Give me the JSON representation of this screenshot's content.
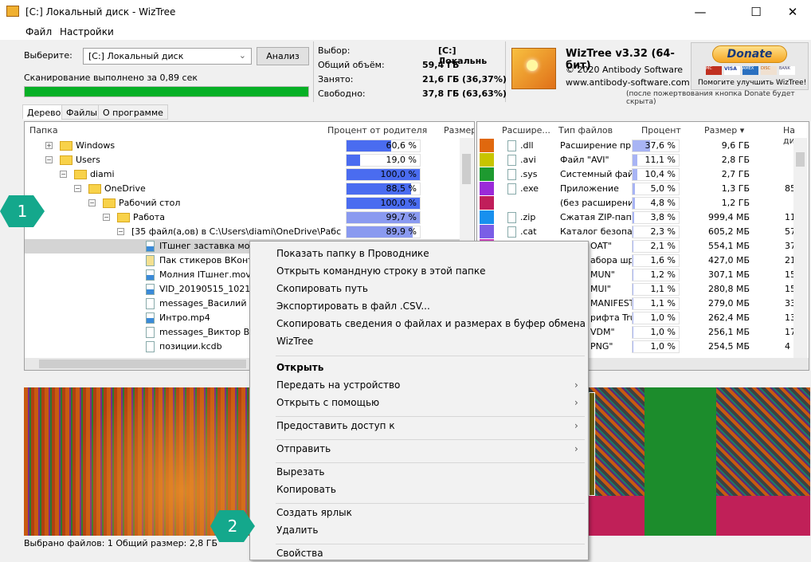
{
  "window": {
    "title": "[C:] Локальный диск  - WizTree",
    "minimize": "—",
    "maximize": "☐",
    "close": "✕"
  },
  "menu": [
    "Файл",
    "Настройки"
  ],
  "scan": {
    "select_label": "Выберите:",
    "drive": "[C:] Локальный диск",
    "analyze": "Анализ",
    "status": "Сканирование выполнено за 0,89 сек",
    "progress_percent": 100
  },
  "stats": {
    "selection_label": "Выбор:",
    "selection_value": "[C:]  Локальнь",
    "total_label": "Общий объём:",
    "total_value": "59,4 ГБ",
    "used_label": "Занято:",
    "used_value": "21,6 ГБ",
    "used_pct": "(36,37%)",
    "free_label": "Свободно:",
    "free_value": "37,8 ГБ",
    "free_pct": "(63,63%)"
  },
  "about": {
    "name": "WizTree v3.32 (64-бит)",
    "copyright": "© 2020 Antibody Software",
    "url": "www.antibody-software.com",
    "donate": "Donate",
    "help": "Помогите улучшить WizTree!",
    "note": "(после пожертвования кнопка Donate будет скрыта)",
    "cards": [
      "MC",
      "VISA",
      "AMEX",
      "DISC",
      "BANK"
    ]
  },
  "tabs": [
    "Дерево",
    "Файлы",
    "О программе"
  ],
  "tree": {
    "headers": [
      "Папка",
      "Процент от родителя",
      "Размер"
    ],
    "rows": [
      {
        "name": "Windows",
        "pct": "60,6 %",
        "fill": 60.6,
        "level": 1,
        "exp": "+",
        "type": "folder"
      },
      {
        "name": "Users",
        "pct": "19,0 %",
        "fill": 19,
        "level": 1,
        "exp": "−",
        "type": "folder"
      },
      {
        "name": "diami",
        "pct": "100,0 %",
        "fill": 100,
        "level": 2,
        "exp": "−",
        "type": "folder"
      },
      {
        "name": "OneDrive",
        "pct": "88,5 %",
        "fill": 88.5,
        "level": 3,
        "exp": "−",
        "type": "folder"
      },
      {
        "name": "Рабочий стол",
        "pct": "100,0 %",
        "fill": 100,
        "level": 4,
        "exp": "−",
        "type": "folder"
      },
      {
        "name": "Работа",
        "pct": "99,7 %",
        "fill": 99.7,
        "level": 5,
        "exp": "−",
        "type": "folder"
      },
      {
        "name": "[35 файл(а,ов) в C:\\Users\\diami\\OneDrive\\Рабс",
        "pct": "89,9 %",
        "fill": 89.9,
        "level": 6,
        "exp": "−",
        "type": "none"
      },
      {
        "name": "ITшнег заставка молн",
        "level": 7,
        "type": "file"
      },
      {
        "name": "Пак стикеров ВКонта",
        "level": 7,
        "type": "zip"
      },
      {
        "name": "Молния ITшнег.mov",
        "level": 7,
        "type": "file"
      },
      {
        "name": "VID_20190515_102125",
        "level": 7,
        "type": "file"
      },
      {
        "name": "messages_Василий Гр",
        "level": 7,
        "type": "e"
      },
      {
        "name": "Интро.mp4",
        "level": 7,
        "type": "file"
      },
      {
        "name": "messages_Виктор Вел",
        "level": 7,
        "type": "e"
      },
      {
        "name": "позиции.kcdb",
        "level": 7,
        "type": "blank"
      }
    ]
  },
  "ext": {
    "headers": [
      "Расшире...",
      "Тип файлов",
      "Процент",
      "Размер ▾",
      "На ди"
    ],
    "rows": [
      {
        "color": "#e0680e",
        "ext": ".dll",
        "type": "Расширение прил",
        "pct": "37,6 %",
        "fill": 37.6,
        "size": "9,6 ГБ",
        "disk": ""
      },
      {
        "color": "#c8c400",
        "ext": ".avi",
        "type": "Файл \"AVI\"",
        "pct": "11,1 %",
        "fill": 11.1,
        "size": "2,8 ГБ",
        "disk": ""
      },
      {
        "color": "#1e9a30",
        "ext": ".sys",
        "type": "Системный файл",
        "pct": "10,4 %",
        "fill": 10.4,
        "size": "2,7 ГБ",
        "disk": ""
      },
      {
        "color": "#9a2ad8",
        "ext": ".exe",
        "type": "Приложение",
        "pct": "5,0 %",
        "fill": 5,
        "size": "1,3 ГБ",
        "disk": "85"
      },
      {
        "color": "#c01e5a",
        "ext": "",
        "type": "(без расширения)",
        "pct": "4,8 %",
        "fill": 4.8,
        "size": "1,2 ГБ",
        "disk": ""
      },
      {
        "color": "#1890ee",
        "ext": ".zip",
        "type": "Сжатая ZIP-папка",
        "pct": "3,8 %",
        "fill": 3.8,
        "size": "999,4 МБ",
        "disk": "11"
      },
      {
        "color": "#7a5ee6",
        "ext": ".cat",
        "type": "Каталог безопасн",
        "pct": "2,3 %",
        "fill": 2.3,
        "size": "605,2 МБ",
        "disk": "57"
      },
      {
        "color": "#d040c0",
        "ext": "",
        "type": "OAT\"",
        "pct": "2,1 %",
        "fill": 2.1,
        "size": "554,1 МБ",
        "disk": "37",
        "clipped": true
      },
      {
        "color": "#8a8a8a",
        "ext": "",
        "type": "абора шри",
        "pct": "1,6 %",
        "fill": 1.6,
        "size": "427,0 МБ",
        "disk": "21",
        "clipped": true
      },
      {
        "color": "#888",
        "ext": "",
        "type": "MUN\"",
        "pct": "1,2 %",
        "fill": 1.2,
        "size": "307,1 МБ",
        "disk": "15",
        "clipped": true
      },
      {
        "color": "#888",
        "ext": "",
        "type": "MUI\"",
        "pct": "1,1 %",
        "fill": 1.1,
        "size": "280,8 МБ",
        "disk": "15",
        "clipped": true
      },
      {
        "color": "#888",
        "ext": "",
        "type": "MANIFEST\"",
        "pct": "1,1 %",
        "fill": 1.1,
        "size": "279,0 МБ",
        "disk": "33",
        "clipped": true
      },
      {
        "color": "#888",
        "ext": "",
        "type": "рифта Tru",
        "pct": "1,0 %",
        "fill": 1,
        "size": "262,4 МБ",
        "disk": "13",
        "clipped": true
      },
      {
        "color": "#888",
        "ext": "",
        "type": "VDM\"",
        "pct": "1,0 %",
        "fill": 1,
        "size": "256,1 МБ",
        "disk": "17",
        "clipped": true
      },
      {
        "color": "#888",
        "ext": "",
        "type": "PNG\"",
        "pct": "1,0 %",
        "fill": 1,
        "size": "254,5 МБ",
        "disk": "4",
        "clipped": true
      }
    ]
  },
  "context_menu": {
    "items": [
      {
        "label": "Показать папку в Проводнике"
      },
      {
        "label": "Открыть командную строку в этой папке"
      },
      {
        "label": "Скопировать путь"
      },
      {
        "label": "Экспортировать в файл .CSV..."
      },
      {
        "label": "Скопировать сведения о файлах и размерах в буфер обмена"
      },
      {
        "label": "WizTree"
      },
      {
        "label": "Открыть",
        "bold": true,
        "sep_before": true
      },
      {
        "label": "Передать на устройство",
        "submenu": true
      },
      {
        "label": "Открыть с помощью",
        "submenu": true
      },
      {
        "label": "Предоставить доступ к",
        "submenu": true,
        "sep_before": true
      },
      {
        "label": "Отправить",
        "submenu": true,
        "sep_before": true
      },
      {
        "label": "Вырезать",
        "sep_before": true
      },
      {
        "label": "Копировать"
      },
      {
        "label": "Создать ярлык",
        "sep_before": true
      },
      {
        "label": "Удалить"
      },
      {
        "label": "Свойства",
        "sep_before": true
      }
    ]
  },
  "status_bar": "Выбрано файлов: 1  Общий размер: 2,8 ГБ",
  "annotations": [
    "1",
    "2"
  ],
  "colors": {
    "progress": "#06b025",
    "bar": "#4a6cf0",
    "selected_row": "#d4d4d4"
  }
}
